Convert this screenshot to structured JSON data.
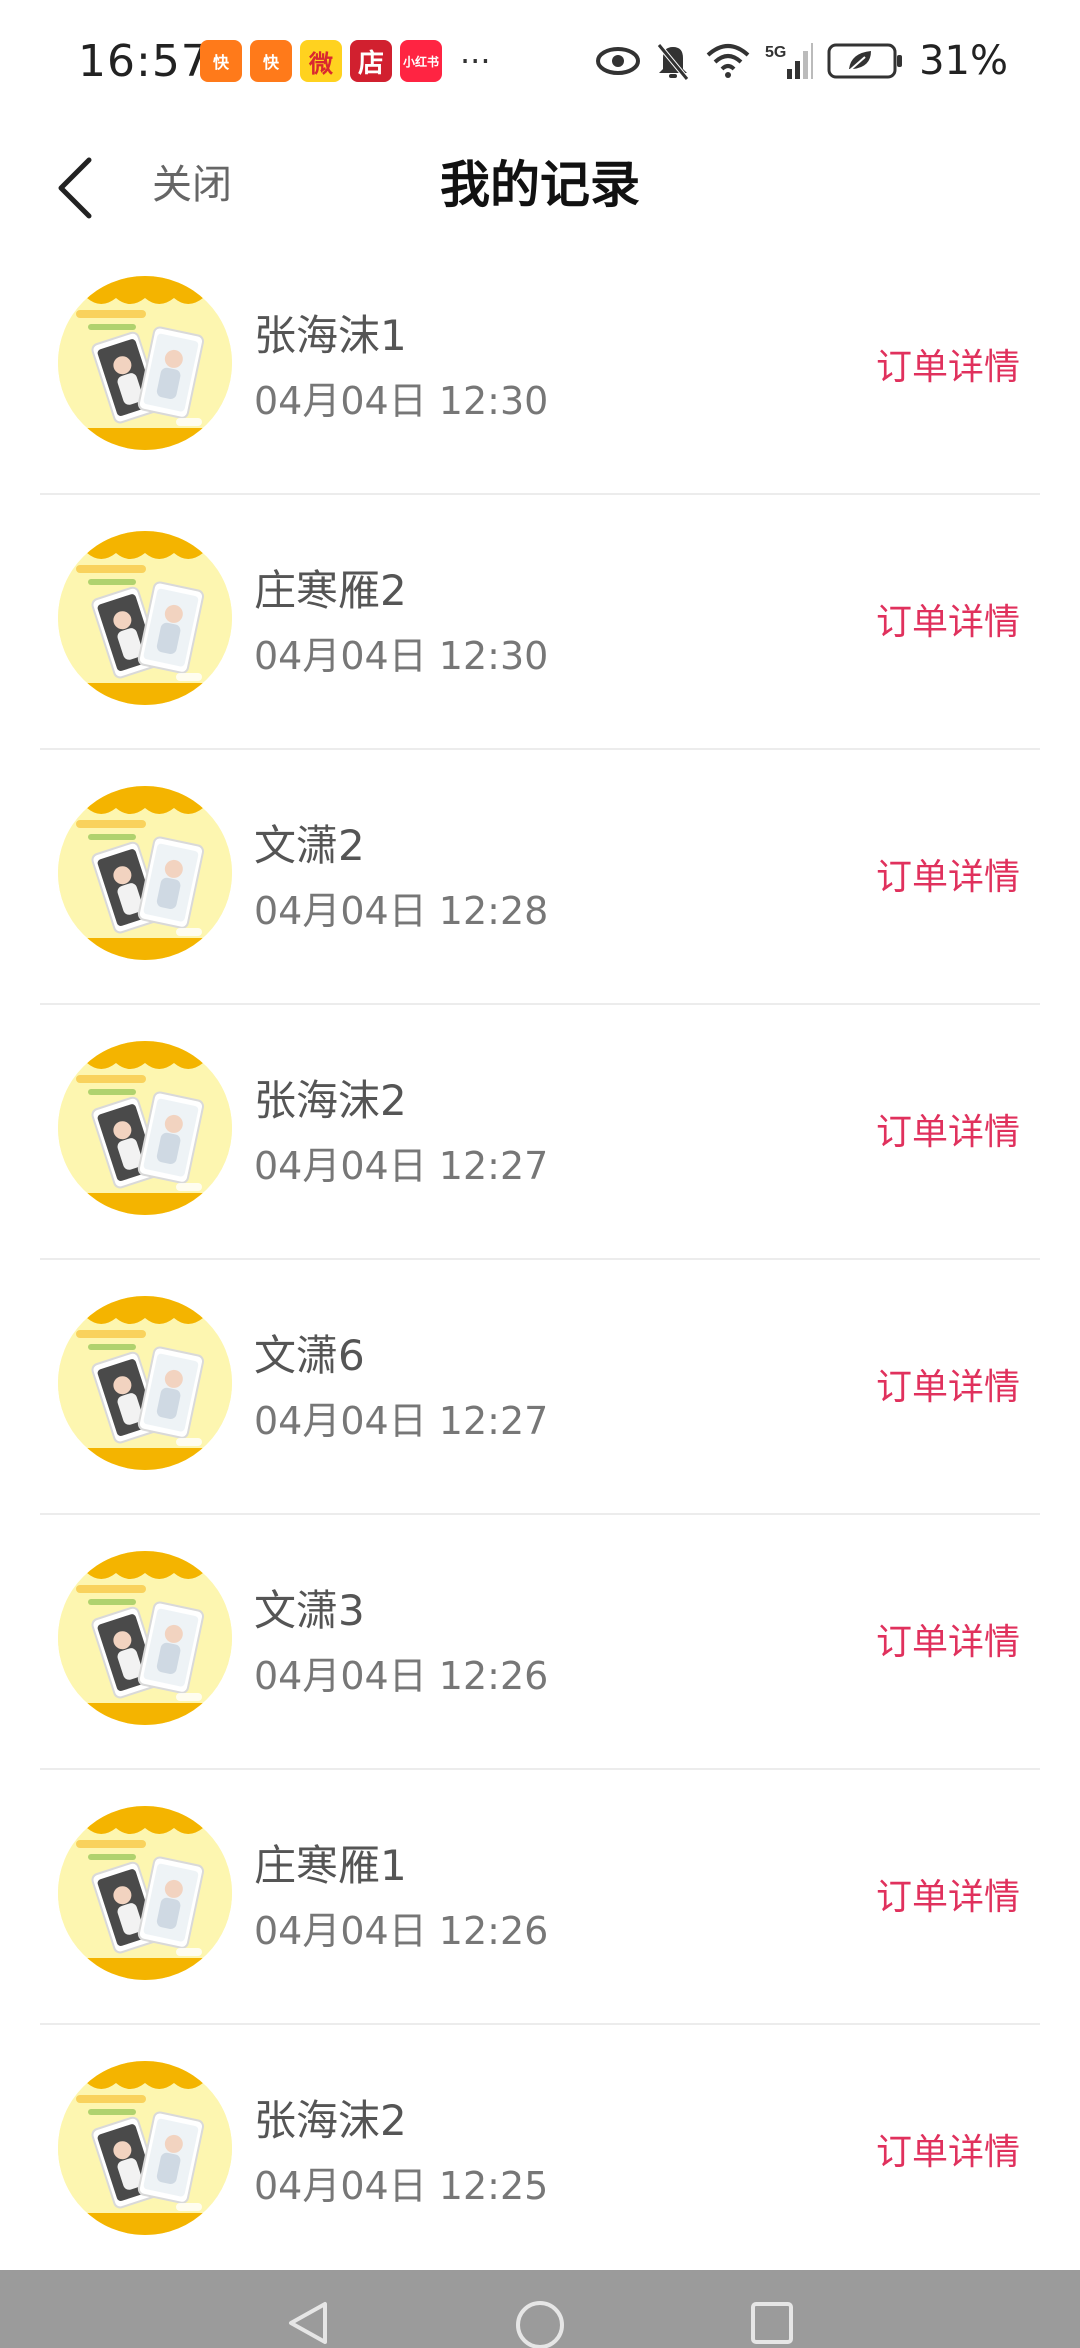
{
  "status_bar": {
    "time": "16:57",
    "app_icons": [
      {
        "name": "kuaishou-icon",
        "label": "快"
      },
      {
        "name": "kuaishou-lite-icon",
        "label": "快"
      },
      {
        "name": "weibo-icon",
        "label": "微"
      },
      {
        "name": "dian-icon",
        "label": "店"
      },
      {
        "name": "xiaohongshu-icon",
        "label": "小红书"
      }
    ],
    "more": "···",
    "network": "5G",
    "battery": "31%"
  },
  "header": {
    "close_label": "关闭",
    "title": "我的记录"
  },
  "records": [
    {
      "name": "张海沫1",
      "time": "04月04日 12:30",
      "action": "订单详情"
    },
    {
      "name": "庄寒雁2",
      "time": "04月04日 12:30",
      "action": "订单详情"
    },
    {
      "name": "文潇2",
      "time": "04月04日 12:28",
      "action": "订单详情"
    },
    {
      "name": "张海沫2",
      "time": "04月04日 12:27",
      "action": "订单详情"
    },
    {
      "name": "文潇6",
      "time": "04月04日 12:27",
      "action": "订单详情"
    },
    {
      "name": "文潇3",
      "time": "04月04日 12:26",
      "action": "订单详情"
    },
    {
      "name": "庄寒雁1",
      "time": "04月04日 12:26",
      "action": "订单详情"
    },
    {
      "name": "张海沫2",
      "time": "04月04日 12:25",
      "action": "订单详情"
    }
  ],
  "colors": {
    "accent": "#e0315d",
    "thumb_bg": "#fdf6b0",
    "thumb_border": "#f4b400",
    "nav_bar": "#9b9b9b"
  }
}
